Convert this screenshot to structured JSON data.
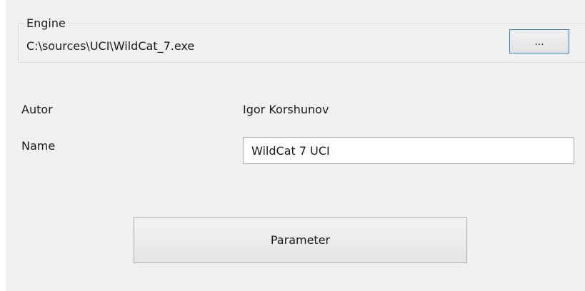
{
  "engine_group": {
    "legend": "Engine",
    "path": "C:\\sources\\UCI\\WildCat_7.exe",
    "browse_label": "..."
  },
  "author": {
    "label": "Autor",
    "value": "Igor Korshunov"
  },
  "name": {
    "label": "Name",
    "value": "WildCat 7 UCI"
  },
  "parameter_button": {
    "label": "Parameter"
  }
}
